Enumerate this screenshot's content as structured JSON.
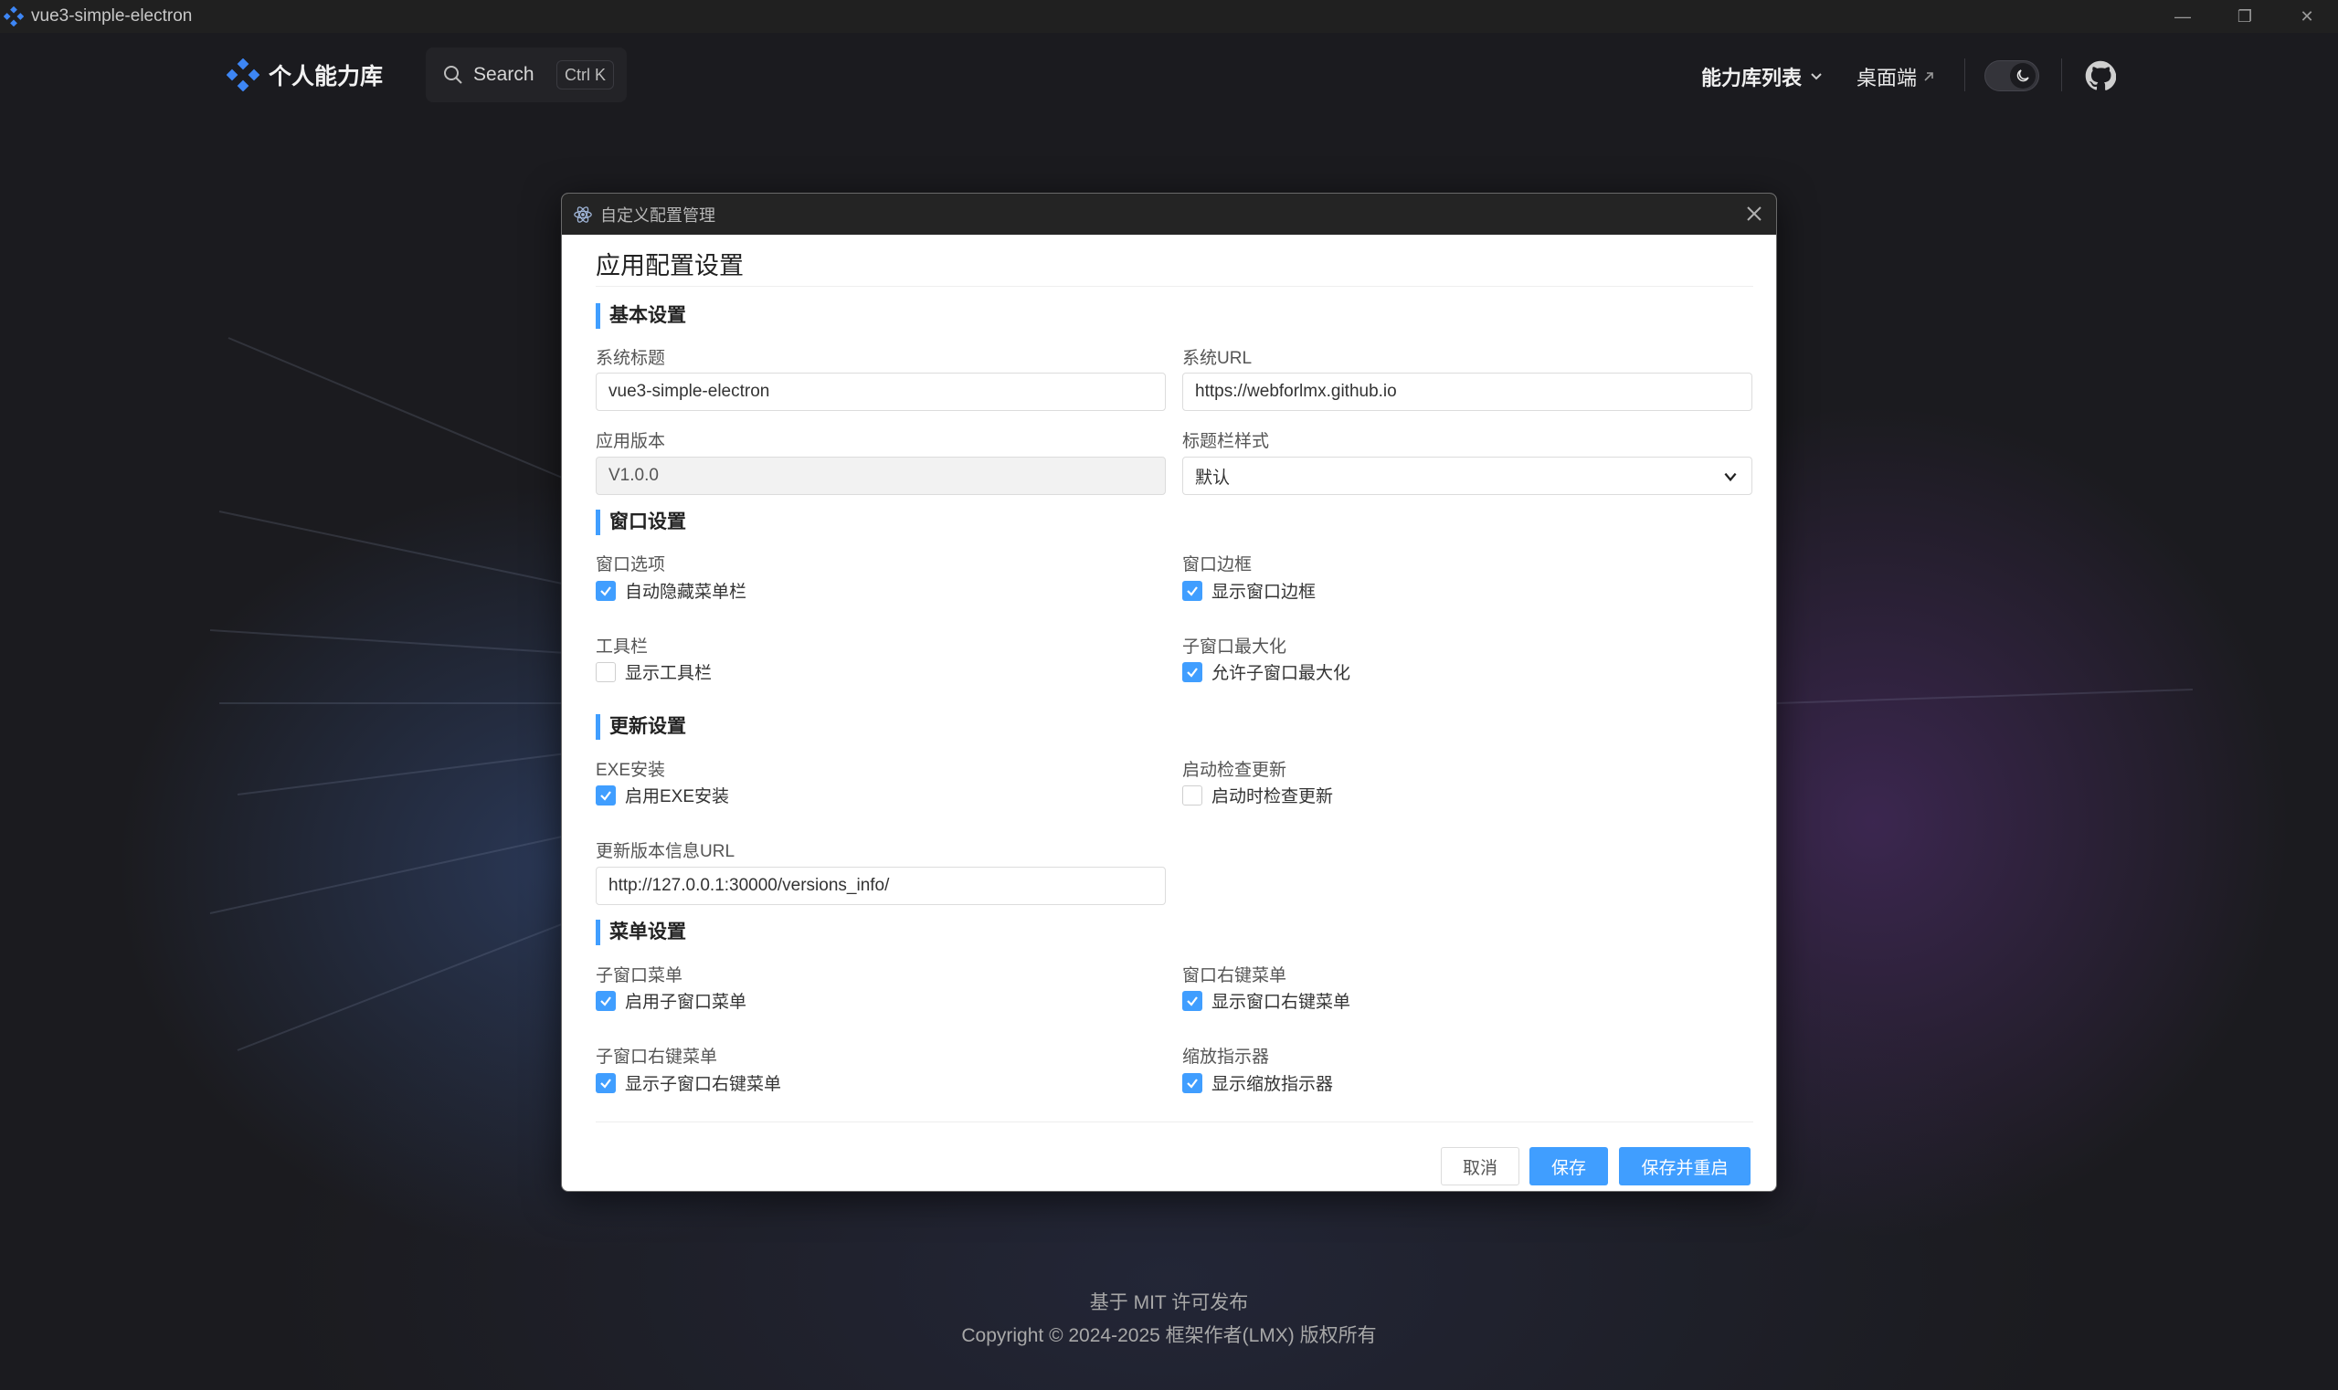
{
  "os_window": {
    "title": "vue3-simple-electron",
    "controls": {
      "minimize": "—",
      "restore": "❐",
      "close": "✕"
    }
  },
  "nav": {
    "brand": "个人能力库",
    "search": {
      "label": "Search",
      "shortcut": "Ctrl K"
    },
    "menu_label": "能力库列表",
    "desktop_link": "桌面端",
    "theme": "dark"
  },
  "dialog": {
    "window_title": "自定义配置管理",
    "title": "应用配置设置",
    "sections": {
      "basic": {
        "title": "基本设置",
        "system_title_label": "系统标题",
        "system_title_value": "vue3-simple-electron",
        "system_url_label": "系统URL",
        "system_url_value": "https://webforlmx.github.io",
        "app_version_label": "应用版本",
        "app_version_value": "V1.0.0",
        "titlebar_style_label": "标题栏样式",
        "titlebar_style_value": "默认"
      },
      "window": {
        "title": "窗口设置",
        "window_options_label": "窗口选项",
        "auto_hide_menu": {
          "label": "自动隐藏菜单栏",
          "checked": true
        },
        "window_border_label": "窗口边框",
        "show_border": {
          "label": "显示窗口边框",
          "checked": true
        },
        "toolbar_label": "工具栏",
        "show_toolbar": {
          "label": "显示工具栏",
          "checked": false
        },
        "child_max_label": "子窗口最大化",
        "allow_child_max": {
          "label": "允许子窗口最大化",
          "checked": true
        }
      },
      "update": {
        "title": "更新设置",
        "exe_label": "EXE安装",
        "enable_exe": {
          "label": "启用EXE安装",
          "checked": true
        },
        "startup_check_label": "启动检查更新",
        "startup_check": {
          "label": "启动时检查更新",
          "checked": false
        },
        "version_url_label": "更新版本信息URL",
        "version_url_value": "http://127.0.0.1:30000/versions_info/"
      },
      "menu": {
        "title": "菜单设置",
        "child_menu_label": "子窗口菜单",
        "enable_child_menu": {
          "label": "启用子窗口菜单",
          "checked": true
        },
        "context_menu_label": "窗口右键菜单",
        "show_context_menu": {
          "label": "显示窗口右键菜单",
          "checked": true
        },
        "child_context_label": "子窗口右键菜单",
        "show_child_context": {
          "label": "显示子窗口右键菜单",
          "checked": true
        },
        "zoom_indicator_label": "缩放指示器",
        "show_zoom_indicator": {
          "label": "显示缩放指示器",
          "checked": true
        }
      }
    },
    "buttons": {
      "cancel": "取消",
      "save": "保存",
      "save_restart": "保存并重启"
    }
  },
  "footer": {
    "license": "基于 MIT 许可发布",
    "copyright": "Copyright © 2024-2025 框架作者(LMX) 版权所有"
  },
  "colors": {
    "accent": "#409eff",
    "background": "#1b1b1f"
  }
}
